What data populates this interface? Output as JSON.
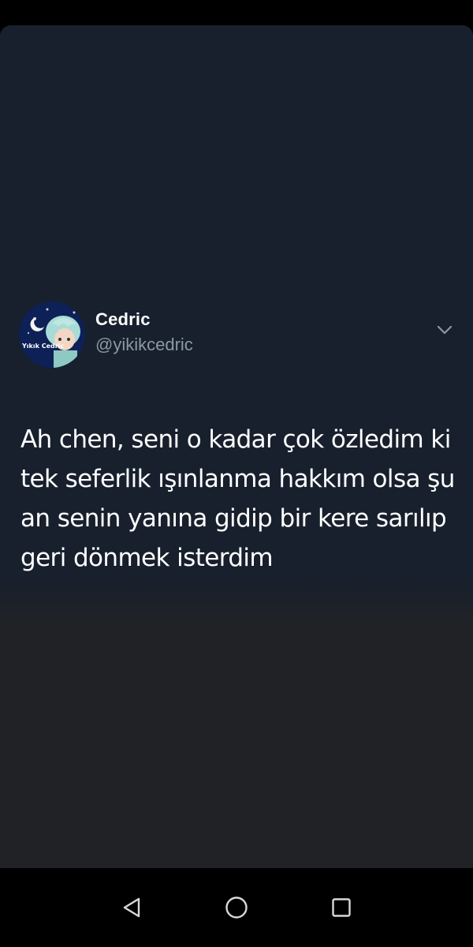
{
  "tweet": {
    "display_name": "Cedric",
    "handle": "@yikikcedric",
    "avatar_label": "Yıkık Cedric",
    "text_lines": [
      "Ah chen, seni o kadar çok özledim ki",
      "tek seferlik ışınlanma hakkım olsa şu",
      "an senin yanına gidip bir kere sarılıp",
      "geri dönmek isterdim"
    ],
    "menu_icon": "chevron-down-icon"
  },
  "nav": {
    "back_icon": "back-triangle-icon",
    "home_icon": "home-circle-icon",
    "recents_icon": "recents-square-icon"
  },
  "colors": {
    "card_bg": "#17202c",
    "surface_bg": "#212226",
    "handle_gray": "#8b98a5",
    "text": "#ffffff"
  }
}
